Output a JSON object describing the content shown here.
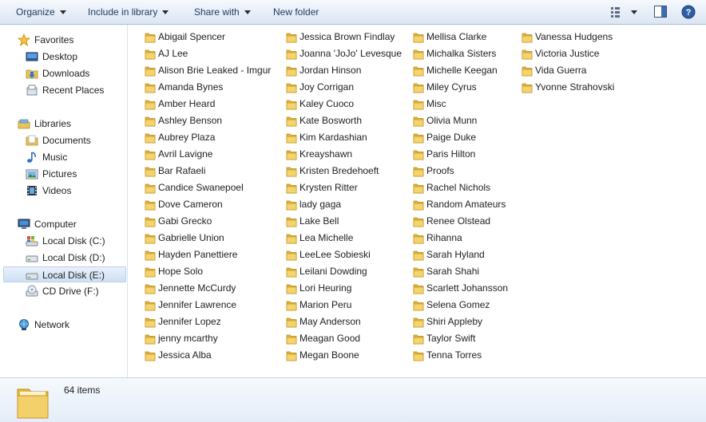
{
  "toolbar": {
    "organize": "Organize",
    "include": "Include in library",
    "share": "Share with",
    "new_folder": "New folder",
    "icons": [
      "view-options-icon",
      "preview-pane-icon",
      "help-icon"
    ]
  },
  "nav": {
    "favorites": {
      "label": "Favorites",
      "items": [
        "Desktop",
        "Downloads",
        "Recent Places"
      ]
    },
    "libraries": {
      "label": "Libraries",
      "items": [
        "Documents",
        "Music",
        "Pictures",
        "Videos"
      ]
    },
    "computer": {
      "label": "Computer",
      "items": [
        "Local Disk (C:)",
        "Local Disk (D:)",
        "Local Disk (E:)",
        "CD Drive (F:)"
      ],
      "selected": "Local Disk (E:)"
    },
    "network": {
      "label": "Network"
    }
  },
  "folders": {
    "col1": [
      "Abigail Spencer",
      "AJ Lee",
      "Alison Brie Leaked - Imgur",
      "Amanda Bynes",
      "Amber Heard",
      "Ashley Benson",
      "Aubrey Plaza",
      "Avril Lavigne",
      "Bar Rafaeli",
      "Candice Swanepoel",
      "Dove Cameron",
      "Gabi Grecko",
      "Gabrielle Union",
      "Hayden Panettiere",
      "Hope Solo",
      "Jennette McCurdy",
      "Jennifer Lawrence",
      "Jennifer Lopez",
      "jenny mcarthy",
      "Jessica Alba"
    ],
    "col2": [
      "Jessica Brown Findlay",
      "Joanna 'JoJo' Levesque",
      "Jordan Hinson",
      "Joy Corrigan",
      "Kaley Cuoco",
      "Kate Bosworth",
      "Kim Kardashian",
      "Kreayshawn",
      "Kristen Bredehoeft",
      "Krysten Ritter",
      "lady gaga",
      "Lake Bell",
      "Lea Michelle",
      "LeeLee Sobieski",
      "Leilani Dowding",
      "Lori Heuring",
      "Marion Peru",
      "May Anderson",
      "Meagan Good",
      "Megan Boone"
    ],
    "col3": [
      "Mellisa Clarke",
      "Michalka Sisters",
      "Michelle Keegan",
      "Miley Cyrus",
      "Misc",
      "Olivia Munn",
      "Paige Duke",
      "Paris Hilton",
      "Proofs",
      "Rachel Nichols",
      "Random Amateurs",
      "Renee Olstead",
      "Rihanna",
      "Sarah Hyland",
      "Sarah Shahi",
      "Scarlett Johansson",
      "Selena Gomez",
      "Shiri Appleby",
      "Taylor Swift",
      "Tenna Torres"
    ],
    "col4": [
      "Vanessa Hudgens",
      "Victoria Justice",
      "Vida Guerra",
      "Yvonne Strahovski"
    ]
  },
  "status": {
    "count": "64 items"
  }
}
